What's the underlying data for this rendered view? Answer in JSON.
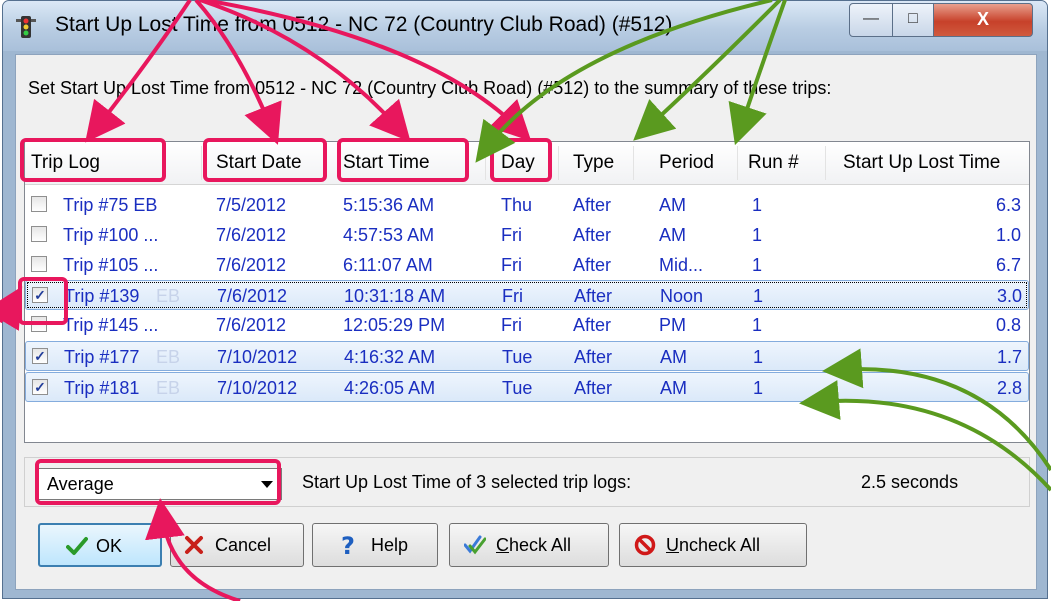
{
  "window": {
    "title": "Start Up Lost Time from 0512 - NC 72 (Country Club Road) (#512)",
    "controls": {
      "minimize": "—",
      "maximize": "□",
      "close": "X"
    }
  },
  "instruction": "Set Start Up Lost Time from 0512 - NC 72 (Country Club Road) (#512) to the summary of these trips:",
  "columns": {
    "trip_log": "Trip Log",
    "start_date": "Start Date",
    "start_time": "Start Time",
    "day": "Day",
    "type": "Type",
    "period": "Period",
    "run": "Run #",
    "lost_time": "Start Up Lost Time"
  },
  "rows": [
    {
      "checked": false,
      "trip": "Trip #75 EB",
      "suffix": "",
      "date": "7/5/2012",
      "time": "5:15:36 AM",
      "day": "Thu",
      "type": "After",
      "period": "AM",
      "run": "1",
      "lost": "6.3",
      "check_mark": ""
    },
    {
      "checked": false,
      "trip": "Trip #100 ...",
      "suffix": "",
      "date": "7/6/2012",
      "time": "4:57:53 AM",
      "day": "Fri",
      "type": "After",
      "period": "AM",
      "run": "1",
      "lost": "1.0",
      "check_mark": ""
    },
    {
      "checked": false,
      "trip": "Trip #105 ...",
      "suffix": "",
      "date": "7/6/2012",
      "time": "6:11:07 AM",
      "day": "Fri",
      "type": "After",
      "period": "Mid...",
      "run": "1",
      "lost": "6.7",
      "check_mark": ""
    },
    {
      "checked": true,
      "trip": "Trip #139",
      "suffix": "EB",
      "date": "7/6/2012",
      "time": "10:31:18 AM",
      "day": "Fri",
      "type": "After",
      "period": "Noon",
      "run": "1",
      "lost": "3.0",
      "check_mark": "✓"
    },
    {
      "checked": false,
      "trip": "Trip #145 ...",
      "suffix": "",
      "date": "7/6/2012",
      "time": "12:05:29 PM",
      "day": "Fri",
      "type": "After",
      "period": "PM",
      "run": "1",
      "lost": "0.8",
      "check_mark": ""
    },
    {
      "checked": true,
      "trip": "Trip #177",
      "suffix": "EB",
      "date": "7/10/2012",
      "time": "4:16:32 AM",
      "day": "Tue",
      "type": "After",
      "period": "AM",
      "run": "1",
      "lost": "1.7",
      "check_mark": "✓"
    },
    {
      "checked": true,
      "trip": "Trip #181",
      "suffix": "EB",
      "date": "7/10/2012",
      "time": "4:26:05 AM",
      "day": "Tue",
      "type": "After",
      "period": "AM",
      "run": "1",
      "lost": "2.8",
      "check_mark": "✓"
    }
  ],
  "summary": {
    "method": "Average",
    "label": "Start Up Lost Time of 3 selected trip logs:",
    "value": "2.5 seconds"
  },
  "buttons": {
    "ok": "OK",
    "cancel": "Cancel",
    "help": "Help",
    "check_all_mnemonic": "C",
    "check_all_rest": "heck All",
    "uncheck_all_mnemonic": "U",
    "uncheck_all_rest": "ncheck All"
  },
  "colors": {
    "highlight": "#e8175d",
    "arrow_green": "#5a9a1f",
    "list_text": "#1a2ec0"
  },
  "icons": {
    "app": "traffic-light-icon",
    "ok": "green-check-icon",
    "cancel": "red-x-icon",
    "help": "question-mark-icon",
    "check_all": "double-check-icon",
    "uncheck_all": "no-entry-icon"
  }
}
